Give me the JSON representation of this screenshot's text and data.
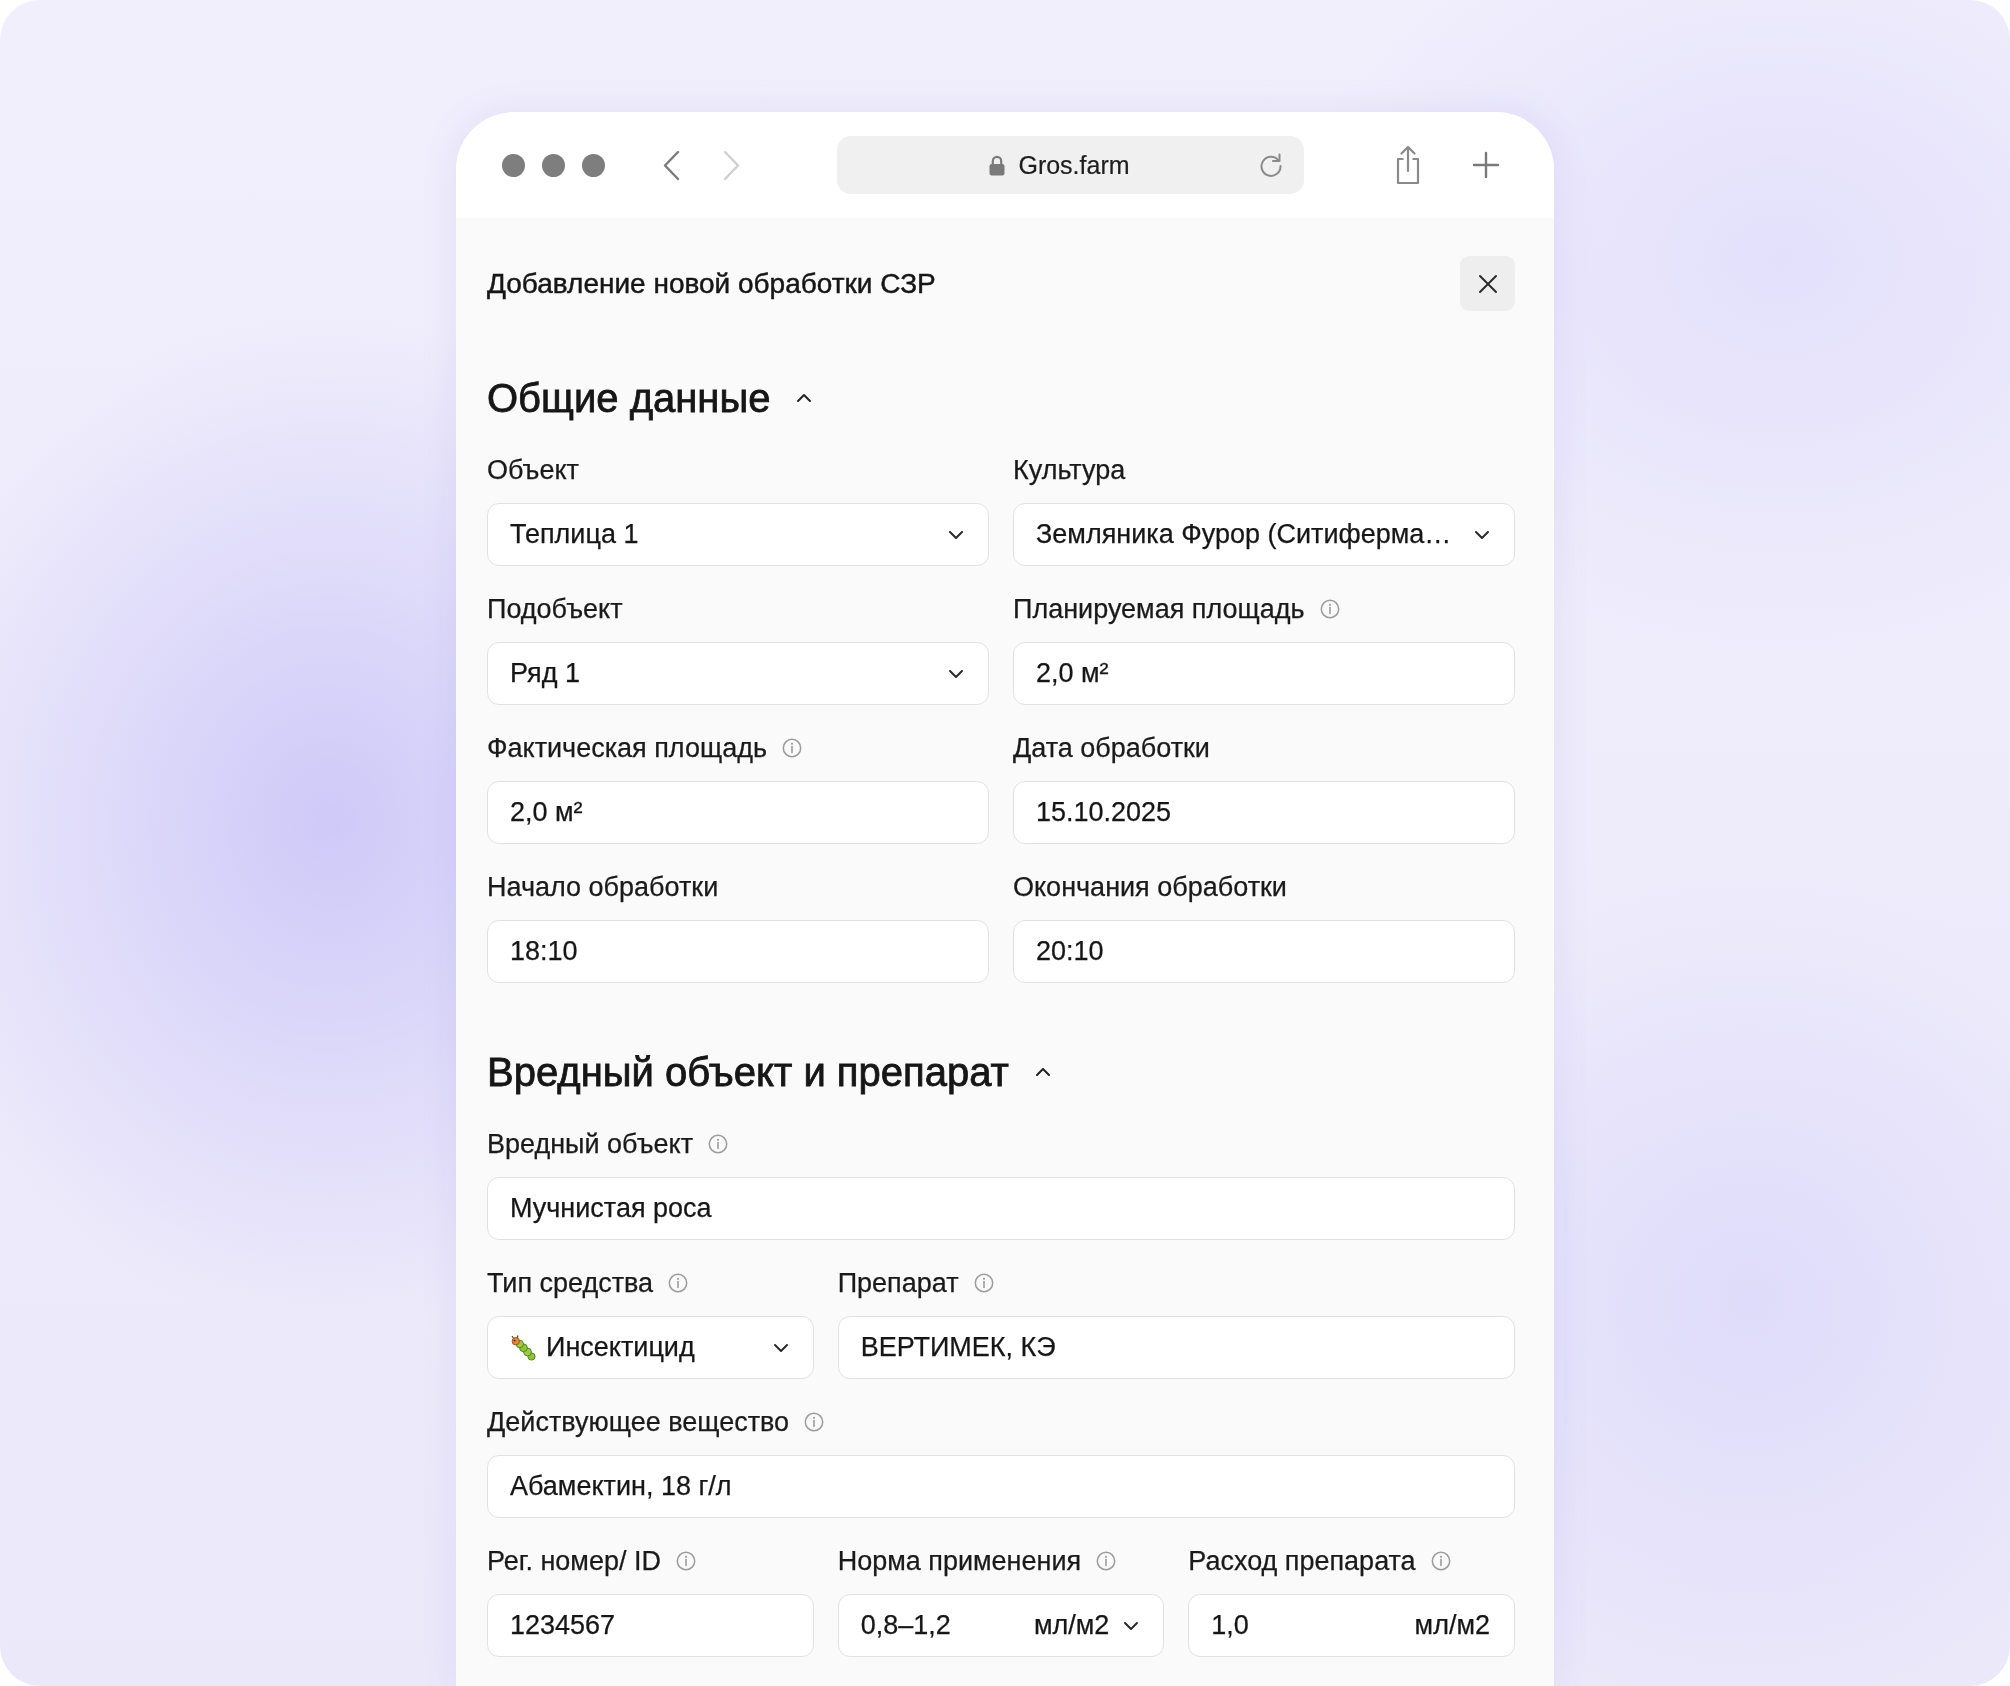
{
  "browser": {
    "url": "Gros.farm",
    "nav": [
      {
        "kind": "back",
        "disabled": false
      },
      {
        "kind": "forward",
        "disabled": true
      }
    ]
  },
  "dialog": {
    "title": "Добавление новой обработки СЗР"
  },
  "sections": [
    {
      "title": "Общие данные",
      "expanded": true,
      "rows": [
        {
          "fields": [
            {
              "label": "Объект",
              "info": false,
              "kind": "select",
              "value": "Теплица 1"
            },
            {
              "label": "Культура",
              "info": false,
              "kind": "select",
              "value": "Земляника Фурор (Ситиферма…"
            }
          ]
        },
        {
          "fields": [
            {
              "label": "Подобъект",
              "info": false,
              "kind": "select",
              "value": "Ряд 1"
            },
            {
              "label": "Планируемая площадь",
              "info": true,
              "kind": "input",
              "value": "2,0 м²"
            }
          ]
        },
        {
          "fields": [
            {
              "label": "Фактическая площадь",
              "info": true,
              "kind": "input",
              "value": "2,0 м²"
            },
            {
              "label": "Дата обработки",
              "info": false,
              "kind": "input",
              "value": "15.10.2025"
            }
          ]
        },
        {
          "fields": [
            {
              "label": "Начало обработки",
              "info": false,
              "kind": "input",
              "value": "18:10"
            },
            {
              "label": "Окончания обработки",
              "info": false,
              "kind": "input",
              "value": "20:10"
            }
          ]
        }
      ]
    },
    {
      "title": "Вредный объект и препарат",
      "expanded": true,
      "rows": [
        {
          "fields": [
            {
              "label": "Вредный объект",
              "info": true,
              "kind": "input",
              "value": "Мучнистая роса"
            }
          ]
        },
        {
          "fields": [
            {
              "label": "Тип средства",
              "info": true,
              "kind": "type_select",
              "value": "Инсектицид"
            },
            {
              "label": "Препарат",
              "info": true,
              "kind": "input",
              "value": "ВЕРТИМЕК, КЭ"
            }
          ]
        },
        {
          "fields": [
            {
              "label": "Действующее вещество",
              "info": true,
              "kind": "input",
              "value": "Абамектин, 18 г/л"
            }
          ]
        },
        {
          "fields": [
            {
              "label": "Рег. номер/ ID",
              "info": true,
              "kind": "input",
              "value": "1234567"
            },
            {
              "label": "Норма применения",
              "info": true,
              "kind": "unit_select",
              "value": "0,8–1,2",
              "unit": "мл/м2"
            },
            {
              "label": "Расход препарата",
              "info": true,
              "kind": "unit_input",
              "value": "1,0",
              "unit": "мл/м2"
            }
          ]
        }
      ]
    }
  ]
}
